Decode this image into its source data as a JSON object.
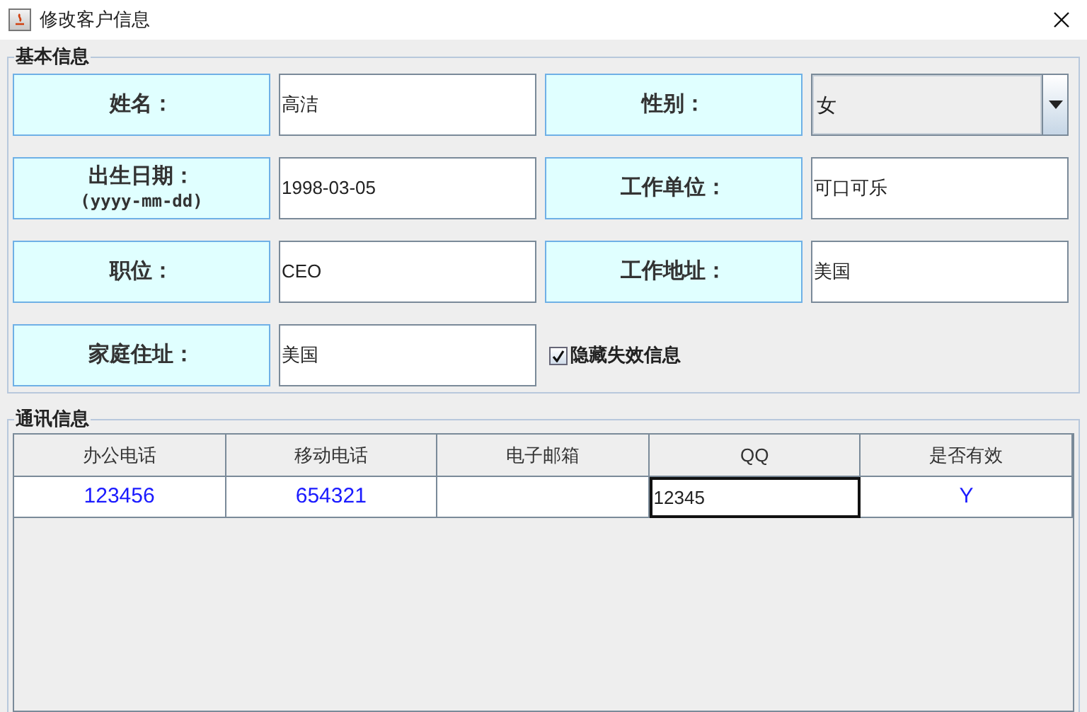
{
  "window": {
    "title": "修改客户信息"
  },
  "basic": {
    "title": "基本信息",
    "fields": [
      {
        "kind": "text",
        "label": "姓名：",
        "value": "高洁"
      },
      {
        "kind": "select",
        "label": "性别：",
        "value": "女"
      },
      {
        "kind": "text",
        "label": "出生日期：",
        "sublabel": "(yyyy-mm-dd)",
        "value": "1998-03-05"
      },
      {
        "kind": "text",
        "label": "工作单位：",
        "value": "可口可乐"
      },
      {
        "kind": "text",
        "label": "职位：",
        "value": "CEO"
      },
      {
        "kind": "text",
        "label": "工作地址：",
        "value": "美国"
      },
      {
        "kind": "text",
        "label": "家庭住址：",
        "value": "美国"
      }
    ],
    "checkbox": {
      "label": "隐藏失效信息",
      "checked": true
    }
  },
  "contacts": {
    "title": "通讯信息",
    "columns": [
      "办公电话",
      "移动电话",
      "电子邮箱",
      "QQ",
      "是否有效"
    ],
    "rows": [
      {
        "cells": [
          {
            "text": "123456",
            "editing": false
          },
          {
            "text": "654321",
            "editing": false
          },
          {
            "text": "",
            "editing": false
          },
          {
            "text": "12345",
            "editing": true
          },
          {
            "text": "Y",
            "editing": false
          }
        ]
      }
    ]
  }
}
